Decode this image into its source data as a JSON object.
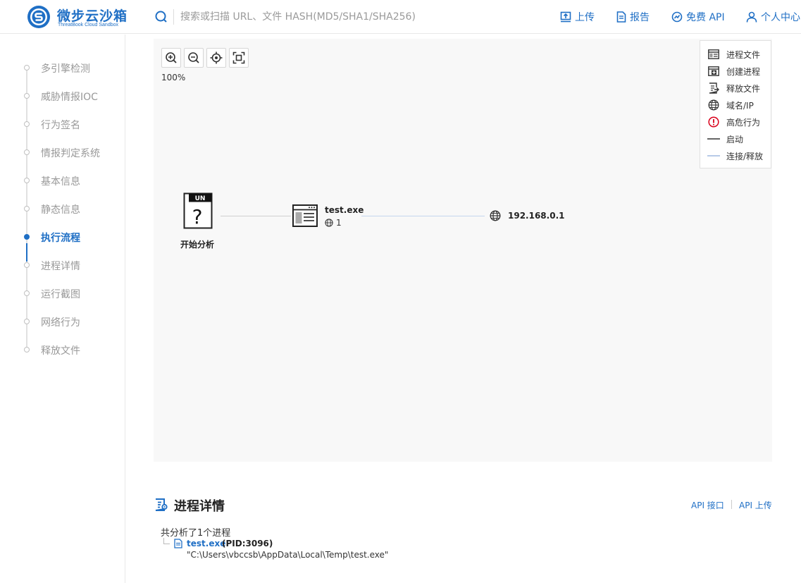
{
  "header": {
    "logo_title": "微步云沙箱",
    "logo_subtitle": "ThreatBook Cloud Sandbox",
    "search_placeholder": "搜索或扫描 URL、文件 HASH(MD5/SHA1/SHA256)",
    "nav": [
      {
        "label": "上传",
        "icon": "upload-icon"
      },
      {
        "label": "报告",
        "icon": "report-icon"
      },
      {
        "label": "免费 API",
        "icon": "api-icon"
      },
      {
        "label": "个人中心",
        "icon": "user-icon"
      }
    ],
    "accent_color": "#1f6fc5"
  },
  "sidebar": {
    "items": [
      {
        "label": "多引擎检测"
      },
      {
        "label": "威胁情报IOC"
      },
      {
        "label": "行为签名"
      },
      {
        "label": "情报判定系统"
      },
      {
        "label": "基本信息"
      },
      {
        "label": "静态信息"
      },
      {
        "label": "执行流程",
        "active": true
      },
      {
        "label": "进程详情"
      },
      {
        "label": "运行截图"
      },
      {
        "label": "网络行为"
      },
      {
        "label": "释放文件"
      }
    ]
  },
  "graph": {
    "toolbar": [
      {
        "name": "zoom-in-icon"
      },
      {
        "name": "zoom-out-icon"
      },
      {
        "name": "locate-icon"
      },
      {
        "name": "fit-screen-icon"
      }
    ],
    "zoom": "100%",
    "legend": [
      {
        "label": "进程文件",
        "icon": "process-file-icon"
      },
      {
        "label": "创建进程",
        "icon": "create-process-icon"
      },
      {
        "label": "释放文件",
        "icon": "release-file-icon"
      },
      {
        "label": "域名/IP",
        "icon": "globe-icon"
      },
      {
        "label": "高危行为",
        "icon": "alert-icon"
      },
      {
        "label": "启动",
        "icon": "start-line"
      },
      {
        "label": "连接/释放",
        "icon": "connect-line"
      }
    ],
    "nodes": {
      "start": {
        "label": "开始分析",
        "badge": "UN",
        "glyph": "?"
      },
      "process": {
        "label": "test.exe",
        "count": "1"
      },
      "ip": {
        "label": "192.168.0.1"
      }
    }
  },
  "details": {
    "title": "进程详情",
    "api_links": [
      "API 接口",
      "API 上传"
    ],
    "summary": "共分析了1个进程",
    "process": {
      "name": "test.exe",
      "pid": "(PID:3096)",
      "cmd": "\"C:\\Users\\vbccsb\\AppData\\Local\\Temp\\test.exe\""
    }
  }
}
